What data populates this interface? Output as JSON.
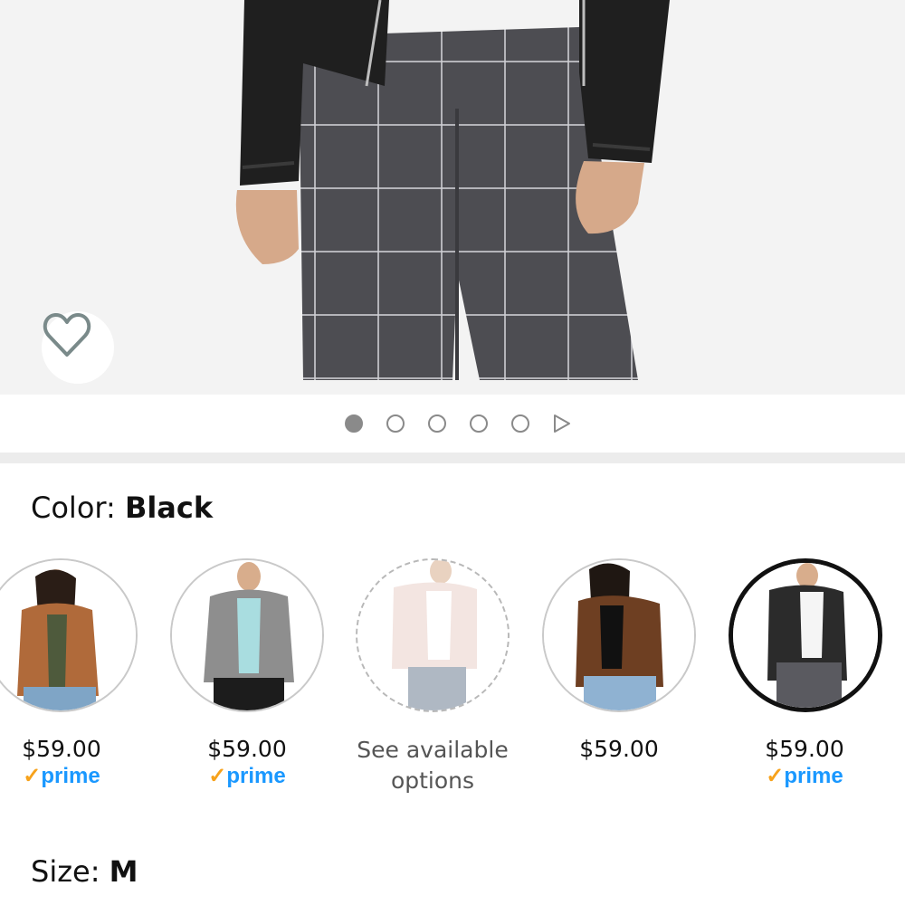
{
  "hero": {
    "image_alt": "Model wearing black leather jacket with grey windowpane plaid pants",
    "wishlist_icon": "heart-outline-icon"
  },
  "carousel": {
    "dot_count": 5,
    "active_index": 0,
    "video_icon": "play-icon"
  },
  "color": {
    "label": "Color: ",
    "value": "Black"
  },
  "swatches": [
    {
      "name": "cognac-jacket",
      "price": "$59.00",
      "prime": "prime",
      "prime_check": "✓",
      "available": true,
      "selected": false,
      "colors": [
        "#b06a3a",
        "#8b4f26"
      ]
    },
    {
      "name": "grey-jacket",
      "price": "$59.00",
      "prime": "prime",
      "prime_check": "✓",
      "available": true,
      "selected": false,
      "colors": [
        "#8e8e8e",
        "#6c6c6c"
      ]
    },
    {
      "name": "blush-jacket",
      "options_line1": "See available",
      "options_line2": "options",
      "available": false,
      "selected": false,
      "colors": [
        "#e9cfc8",
        "#d7b6ad"
      ]
    },
    {
      "name": "brown-jacket",
      "price": "$59.00",
      "available": true,
      "selected": false,
      "colors": [
        "#6e3f22",
        "#52301a"
      ]
    },
    {
      "name": "black-jacket",
      "price": "$59.00",
      "prime": "prime",
      "prime_check": "✓",
      "available": true,
      "selected": true,
      "colors": [
        "#2b2b2b",
        "#1a1a1a"
      ]
    }
  ],
  "size": {
    "label": "Size: ",
    "value": "M"
  }
}
